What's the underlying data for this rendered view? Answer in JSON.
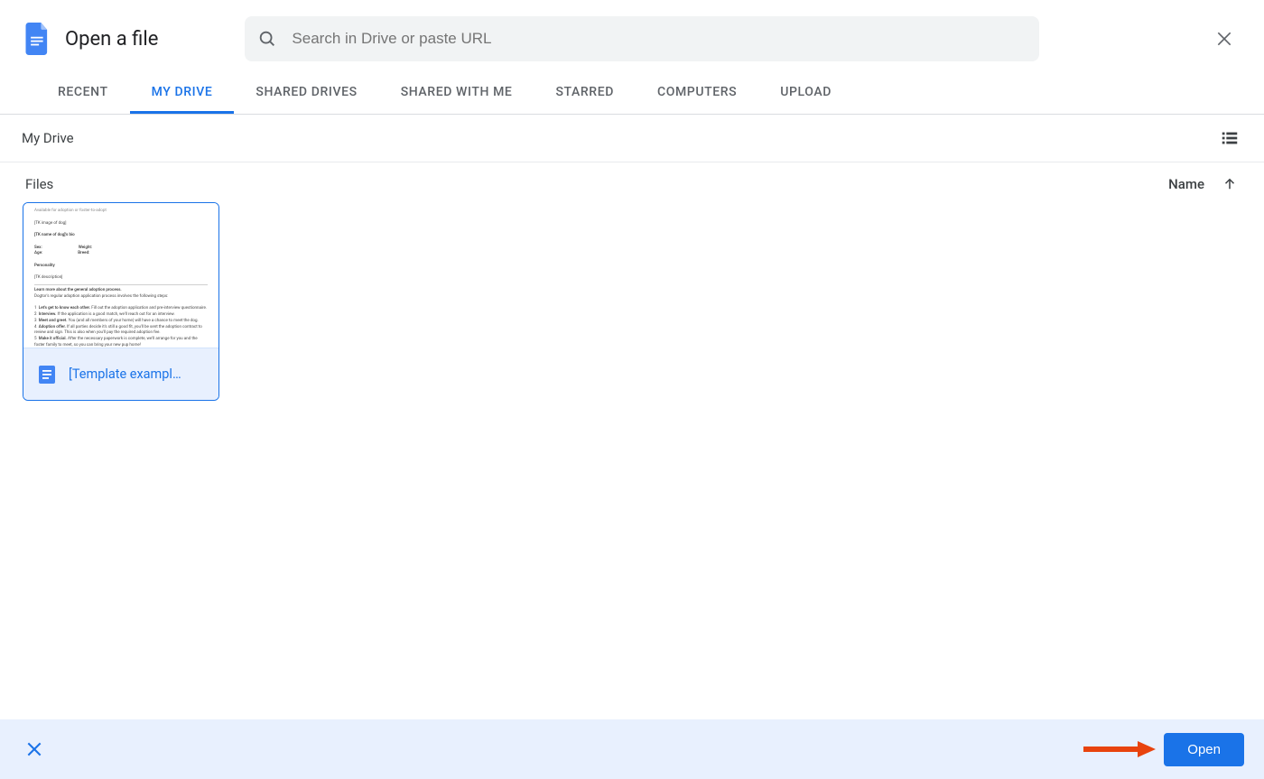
{
  "dialog": {
    "title": "Open a file"
  },
  "search": {
    "placeholder": "Search in Drive or paste URL"
  },
  "tabs": [
    {
      "id": "recent",
      "label": "RECENT",
      "active": false
    },
    {
      "id": "my-drive",
      "label": "MY DRIVE",
      "active": true
    },
    {
      "id": "shared-drives",
      "label": "SHARED DRIVES",
      "active": false
    },
    {
      "id": "shared-with-me",
      "label": "SHARED WITH ME",
      "active": false
    },
    {
      "id": "starred",
      "label": "STARRED",
      "active": false
    },
    {
      "id": "computers",
      "label": "COMPUTERS",
      "active": false
    },
    {
      "id": "upload",
      "label": "UPLOAD",
      "active": false
    }
  ],
  "breadcrumb": "My Drive",
  "section_label": "Files",
  "sort": {
    "column": "Name",
    "direction": "asc"
  },
  "files": [
    {
      "id": "template-example",
      "name": "[Template exampl…",
      "type": "google-doc",
      "selected": true
    }
  ],
  "footer": {
    "open_label": "Open"
  }
}
